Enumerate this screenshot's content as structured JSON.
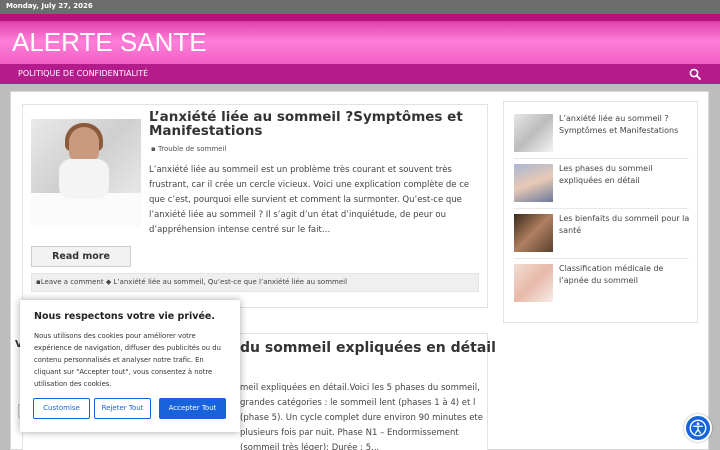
{
  "topbar": {
    "date": "Monday, July 27, 2026"
  },
  "header": {
    "site_title": "ALERTE SANTE"
  },
  "nav": {
    "items": [
      {
        "label": "POLITIQUE DE CONFIDENTIALITÉ"
      }
    ],
    "search_icon": "search-icon"
  },
  "post1": {
    "title": "L’anxiété liée au sommeil ?Symptômes et Manifestations",
    "category": "Trouble de sommeil",
    "excerpt": "L’anxiété liée au sommeil est un problème très courant et souvent très frustrant, car il crée un cercle vicieux. Voici une explication complète de ce que c’est, pourquoi elle survient et comment la surmonter. Qu’est-ce que l’anxiété liée au sommeil ? Il s’agit d’un état d’inquiétude, de peur ou d’appréhension intense centré sur le fait…",
    "read_more": "Read more",
    "meta_comment": "Leave a comment",
    "meta_tags": "L’anxiété liée au sommeil, Qu’est-ce que l’anxiété liée au sommeil"
  },
  "post2": {
    "title_visible": "du sommeil expliquées en détail",
    "excerpt_visible": "meil expliquées en détail.Voici les 5 phases du sommeil, grandes catégories : le sommeil lent (phases 1 à 4) et l (phase 5). Un cycle complet dure environ 90 minutes ete plusieurs fois par nuit. Phase N1 – Endormissement (sommeil très léger): Durée : 5..."
  },
  "sidebar": {
    "items": [
      {
        "label": "L’anxiété liée au sommeil ? Symptômes et Manifestations",
        "icon": "woman-bed-thumbnail"
      },
      {
        "label": "Les phases du sommeil expliquées en détail",
        "icon": "baby-sleep-thumbnail"
      },
      {
        "label": "Les bienfaits du sommeil pour la santé",
        "icon": "man-sleep-thumbnail"
      },
      {
        "label": "Classification médicale de l’apnée du sommeil",
        "icon": "woman-sleep-thumbnail"
      }
    ]
  },
  "cookie": {
    "title": "Nous respectons votre vie privée.",
    "text": "Nous utilisons des cookies pour améliorer votre expérience de navigation, diffuser des publicités ou du contenu personnalisés et analyser notre trafic. En cliquant sur \"Accepter tout\", vous consentez à notre utilisation des cookies.",
    "customize": "Customise",
    "reject": "Rejeter Tout",
    "accept": "Accepter Tout"
  },
  "partial": {
    "letter": "V"
  },
  "colors": {
    "brand_pink": "#b41c8c",
    "header_light": "#ff7fd8",
    "accent_blue": "#1863dc"
  }
}
